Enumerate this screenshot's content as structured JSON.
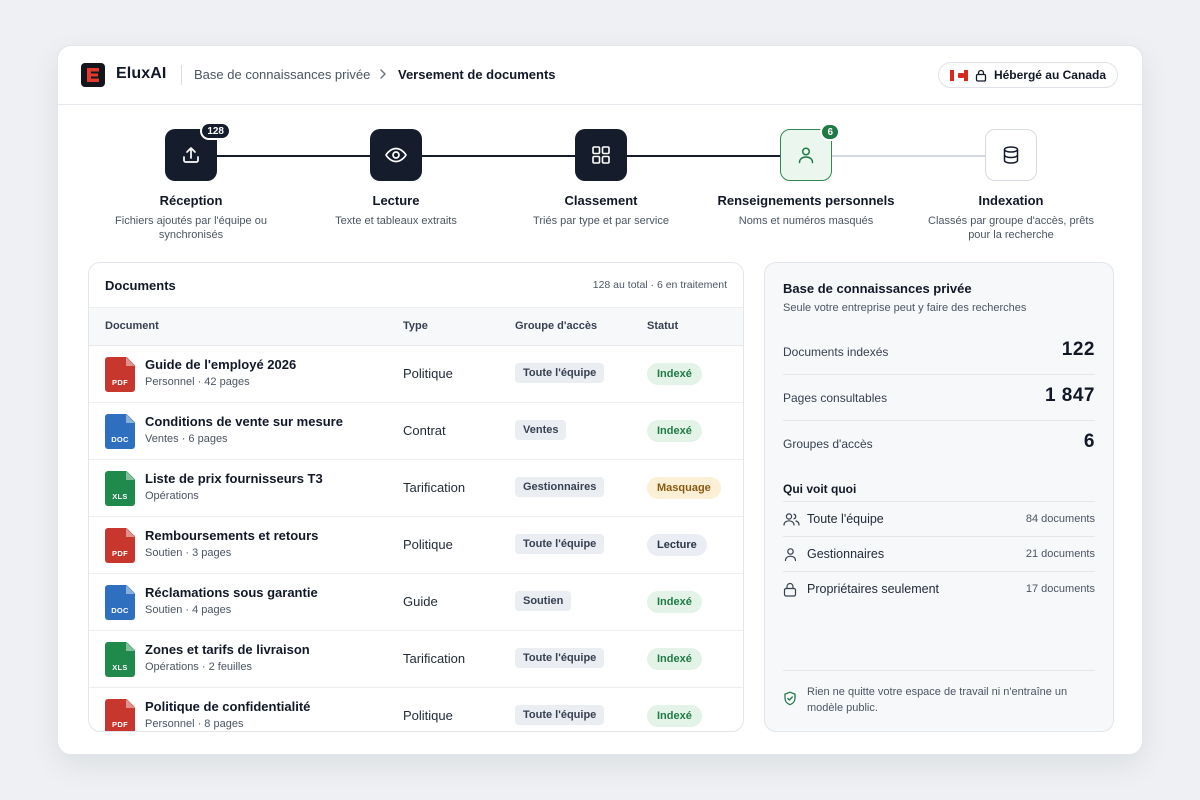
{
  "header": {
    "brand": "EluxAI",
    "breadcrumb": [
      "Base de connaissances privée",
      "Versement de documents"
    ],
    "hosted_label": "Hébergé au Canada"
  },
  "steps": [
    {
      "title": "Réception",
      "desc": "Fichiers ajoutés par l'équipe ou synchronisés",
      "badge": "128",
      "icon": "upload-icon",
      "state": "done"
    },
    {
      "title": "Lecture",
      "desc": "Texte et tableaux extraits",
      "badge": "",
      "icon": "eye-icon",
      "state": "done"
    },
    {
      "title": "Classement",
      "desc": "Triés par type et par service",
      "badge": "",
      "icon": "grid-icon",
      "state": "done"
    },
    {
      "title": "Renseignements personnels",
      "desc": "Noms et numéros masqués",
      "badge": "6",
      "icon": "user-icon",
      "state": "active"
    },
    {
      "title": "Indexation",
      "desc": "Classés par groupe d'accès, prêts pour la recherche",
      "badge": "",
      "icon": "database-icon",
      "state": "pending"
    }
  ],
  "documents": {
    "title": "Documents",
    "count": "128 au total · 6 en traitement",
    "columns": [
      "Document",
      "Type",
      "Groupe d'accès",
      "Statut"
    ],
    "rows": [
      {
        "name": "Guide de l'employé 2026",
        "meta": "Personnel · 42 pages",
        "ext": "PDF",
        "type": "Politique",
        "group": "Toute l'équipe",
        "status": "Indexé",
        "status_kind": "indexed"
      },
      {
        "name": "Conditions de vente sur mesure",
        "meta": "Ventes · 6 pages",
        "ext": "DOC",
        "type": "Contrat",
        "group": "Ventes",
        "status": "Indexé",
        "status_kind": "indexed"
      },
      {
        "name": "Liste de prix fournisseurs T3",
        "meta": "Opérations",
        "ext": "XLS",
        "type": "Tarification",
        "group": "Gestionnaires",
        "status": "Masquage",
        "status_kind": "masking"
      },
      {
        "name": "Remboursements et retours",
        "meta": "Soutien · 3 pages",
        "ext": "PDF",
        "type": "Politique",
        "group": "Toute l'équipe",
        "status": "Lecture",
        "status_kind": "reading"
      },
      {
        "name": "Réclamations sous garantie",
        "meta": "Soutien · 4 pages",
        "ext": "DOC",
        "type": "Guide",
        "group": "Soutien",
        "status": "Indexé",
        "status_kind": "indexed"
      },
      {
        "name": "Zones et tarifs de livraison",
        "meta": "Opérations · 2 feuilles",
        "ext": "XLS",
        "type": "Tarification",
        "group": "Toute l'équipe",
        "status": "Indexé",
        "status_kind": "indexed"
      },
      {
        "name": "Politique de confidentialité",
        "meta": "Personnel · 8 pages",
        "ext": "PDF",
        "type": "Politique",
        "group": "Toute l'équipe",
        "status": "Indexé",
        "status_kind": "indexed"
      }
    ]
  },
  "knowledge_base": {
    "title": "Base de connaissances privée",
    "subtitle": "Seule votre entreprise peut y faire des recherches",
    "stats": [
      {
        "label": "Documents indexés",
        "value": "122"
      },
      {
        "label": "Pages consultables",
        "value": "1 847"
      },
      {
        "label": "Groupes d'accès",
        "value": "6"
      }
    ],
    "who_title": "Qui voit quoi",
    "who": [
      {
        "label": "Toute l'équipe",
        "count": "84 documents",
        "icon": "users-icon"
      },
      {
        "label": "Gestionnaires",
        "count": "21 documents",
        "icon": "user-icon"
      },
      {
        "label": "Propriétaires seulement",
        "count": "17 documents",
        "icon": "lock-icon"
      }
    ],
    "footer": "Rien ne quitte votre espace de travail ni n'entraîne un modèle public."
  },
  "colors": {
    "primary_dark": "#151c2c",
    "success": "#1f7a45",
    "pdf": "#c8372d",
    "doc": "#2f6fbf",
    "xls": "#1f8a4c"
  }
}
